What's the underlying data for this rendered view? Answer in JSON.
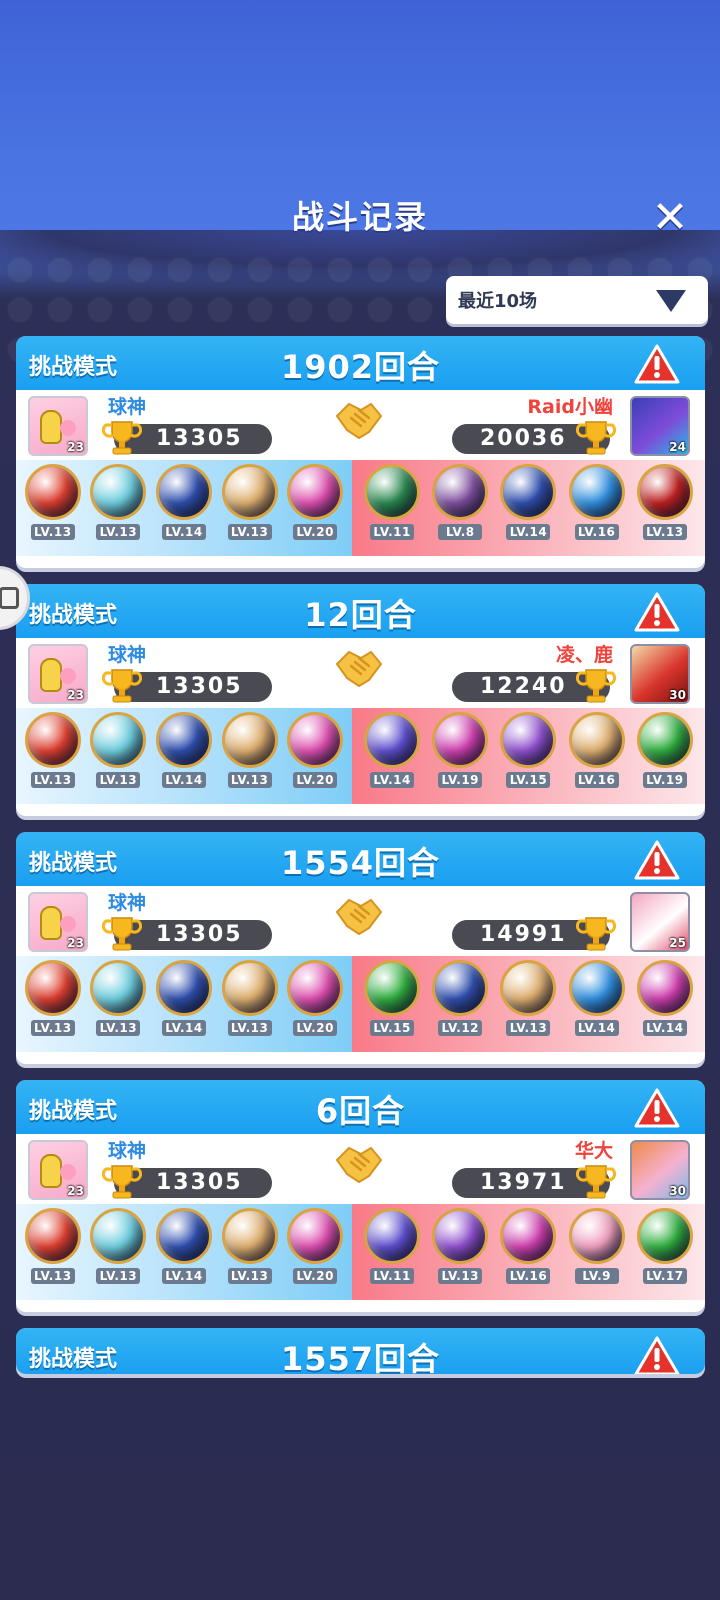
{
  "header": {
    "title": "战斗记录",
    "close_label": "✕"
  },
  "filter": {
    "selected": "最近10场"
  },
  "colors": {
    "header_blue": "#1a9ff0",
    "left_name": "#2d8be0",
    "right_name": "#f0433c"
  },
  "records": [
    {
      "mode": "挑战模式",
      "rounds": "1902回合",
      "left": {
        "name": "球神",
        "score": "13305",
        "avatar_level": "23"
      },
      "right": {
        "name": "Raid小幽",
        "score": "20036",
        "avatar_level": "24"
      },
      "left_skills": [
        {
          "lv": "LV.13",
          "color": "#e04030"
        },
        {
          "lv": "LV.13",
          "color": "#6fd0e0"
        },
        {
          "lv": "LV.14",
          "color": "#3050b0"
        },
        {
          "lv": "LV.13",
          "color": "#e0b070"
        },
        {
          "lv": "LV.20",
          "color": "#e050b0"
        }
      ],
      "right_skills": [
        {
          "lv": "LV.11",
          "color": "#2a8a50"
        },
        {
          "lv": "LV.8",
          "color": "#8050a0"
        },
        {
          "lv": "LV.14",
          "color": "#3050b0"
        },
        {
          "lv": "LV.16",
          "color": "#3090e0"
        },
        {
          "lv": "LV.13",
          "color": "#c02020"
        }
      ]
    },
    {
      "mode": "挑战模式",
      "rounds": "12回合",
      "left": {
        "name": "球神",
        "score": "13305",
        "avatar_level": "23"
      },
      "right": {
        "name": "凌、鹿",
        "score": "12240",
        "avatar_level": "30"
      },
      "left_skills": [
        {
          "lv": "LV.13",
          "color": "#e04030"
        },
        {
          "lv": "LV.13",
          "color": "#6fd0e0"
        },
        {
          "lv": "LV.14",
          "color": "#3050b0"
        },
        {
          "lv": "LV.13",
          "color": "#e0b070"
        },
        {
          "lv": "LV.20",
          "color": "#e050b0"
        }
      ],
      "right_skills": [
        {
          "lv": "LV.14",
          "color": "#6050d0"
        },
        {
          "lv": "LV.19",
          "color": "#d040b0"
        },
        {
          "lv": "LV.15",
          "color": "#9050d0"
        },
        {
          "lv": "LV.16",
          "color": "#e0b070"
        },
        {
          "lv": "LV.19",
          "color": "#30b040"
        }
      ]
    },
    {
      "mode": "挑战模式",
      "rounds": "1554回合",
      "left": {
        "name": "球神",
        "score": "13305",
        "avatar_level": "23"
      },
      "right": {
        "name": "",
        "score": "14991",
        "avatar_level": "25"
      },
      "left_skills": [
        {
          "lv": "LV.13",
          "color": "#e04030"
        },
        {
          "lv": "LV.13",
          "color": "#6fd0e0"
        },
        {
          "lv": "LV.14",
          "color": "#3050b0"
        },
        {
          "lv": "LV.13",
          "color": "#e0b070"
        },
        {
          "lv": "LV.20",
          "color": "#e050b0"
        }
      ],
      "right_skills": [
        {
          "lv": "LV.15",
          "color": "#30b040"
        },
        {
          "lv": "LV.12",
          "color": "#3050b0"
        },
        {
          "lv": "LV.13",
          "color": "#e0b070"
        },
        {
          "lv": "LV.14",
          "color": "#3090e0"
        },
        {
          "lv": "LV.14",
          "color": "#d040b0"
        }
      ]
    },
    {
      "mode": "挑战模式",
      "rounds": "6回合",
      "left": {
        "name": "球神",
        "score": "13305",
        "avatar_level": "23"
      },
      "right": {
        "name": "华大",
        "score": "13971",
        "avatar_level": "30"
      },
      "left_skills": [
        {
          "lv": "LV.13",
          "color": "#e04030"
        },
        {
          "lv": "LV.13",
          "color": "#6fd0e0"
        },
        {
          "lv": "LV.14",
          "color": "#3050b0"
        },
        {
          "lv": "LV.13",
          "color": "#e0b070"
        },
        {
          "lv": "LV.20",
          "color": "#e050b0"
        }
      ],
      "right_skills": [
        {
          "lv": "LV.11",
          "color": "#6050d0"
        },
        {
          "lv": "LV.13",
          "color": "#9050d0"
        },
        {
          "lv": "LV.16",
          "color": "#d040b0"
        },
        {
          "lv": "LV.9",
          "color": "#f0a0c0"
        },
        {
          "lv": "LV.17",
          "color": "#30b040"
        }
      ]
    }
  ],
  "partial_record": {
    "mode": "挑战模式",
    "rounds": "1557回合"
  }
}
